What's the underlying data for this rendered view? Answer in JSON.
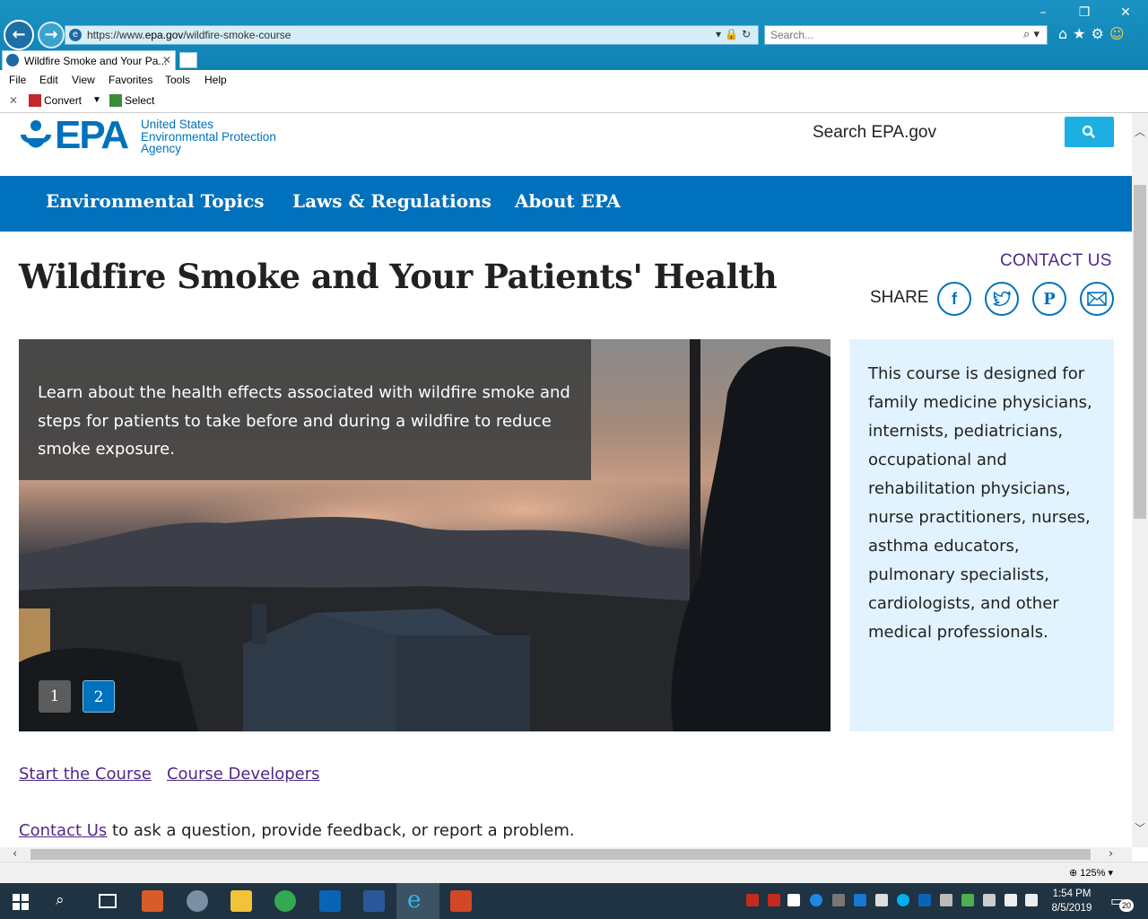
{
  "browser": {
    "url_prefix": "https://www.",
    "url_host": "epa.gov",
    "url_path": "/wildfire-smoke-course",
    "search_placeholder": "Search...",
    "tab_title": "Wildfire Smoke and Your Pa...",
    "menu": [
      "File",
      "Edit",
      "View",
      "Favorites",
      "Tools",
      "Help"
    ],
    "toolbar": {
      "convert_label": "Convert",
      "select_label": "Select"
    },
    "zoom": "125%"
  },
  "site": {
    "logo_text": "EPA",
    "agency_line1": "United States",
    "agency_line2": "Environmental Protection",
    "agency_line3": "Agency",
    "search_placeholder": "Search EPA.gov"
  },
  "nav": {
    "items": [
      "Environmental Topics",
      "Laws & Regulations",
      "About EPA"
    ]
  },
  "page": {
    "title": "Wildfire Smoke and Your Patients' Health",
    "contact_us": "CONTACT US",
    "share_label": "SHARE",
    "hero_caption": "Learn about the health effects associated with wildfire smoke and steps for patients to take before and during a wildfire to reduce smoke exposure.",
    "slides": [
      "1",
      "2"
    ],
    "aside_text": "This course is designed for family medicine physicians, internists, pediatricians, occupational and rehabilitation physicians, nurse practitioners, nurses, asthma educators, pulmonary specialists, cardiologists, and other medical professionals.",
    "link_start": "Start the Course",
    "link_developers": "Course Developers",
    "link_contact": "Contact Us",
    "contact_suffix": " to ask a question, provide feedback, or report a problem."
  },
  "taskbar": {
    "time": "1:54 PM",
    "date": "8/5/2019",
    "notifications": "20"
  },
  "colors": {
    "epa_blue": "#0071bc",
    "search_button": "#1cb0e2",
    "link_purple": "#4e2a84",
    "aside_bg": "#e1f3ff",
    "active_slide": "#0071bc",
    "inactive_slide": "#5c5c5c"
  }
}
